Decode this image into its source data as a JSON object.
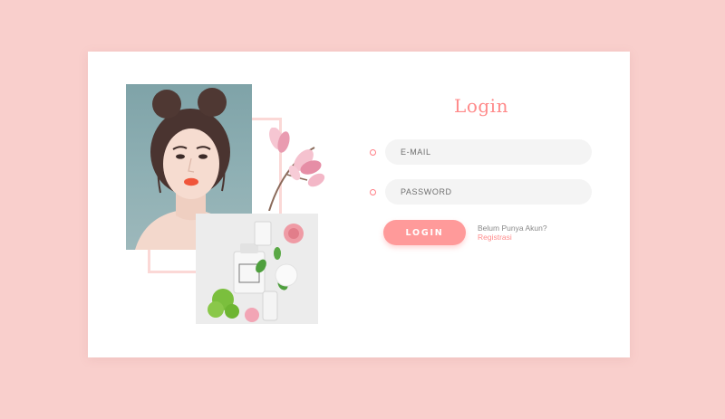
{
  "colors": {
    "page_background": "#f9cfcc",
    "card_background": "#ffffff",
    "accent": "#ff9a9a",
    "title": "#ff8a8a",
    "input_background": "#f4f4f4"
  },
  "images": {
    "portrait": "portrait photo",
    "products": "cosmetic bottles with flowers",
    "flowers": "pink magnolia branch"
  },
  "login": {
    "title": "Login",
    "email_placeholder": "E-MAIL",
    "email_icon": "dot-icon",
    "password_placeholder": "PASSWORD",
    "password_icon": "dot-icon",
    "button_label": "LOGIN",
    "register_prompt": "Belum Punya Akun?",
    "register_link": "Registrasi"
  }
}
